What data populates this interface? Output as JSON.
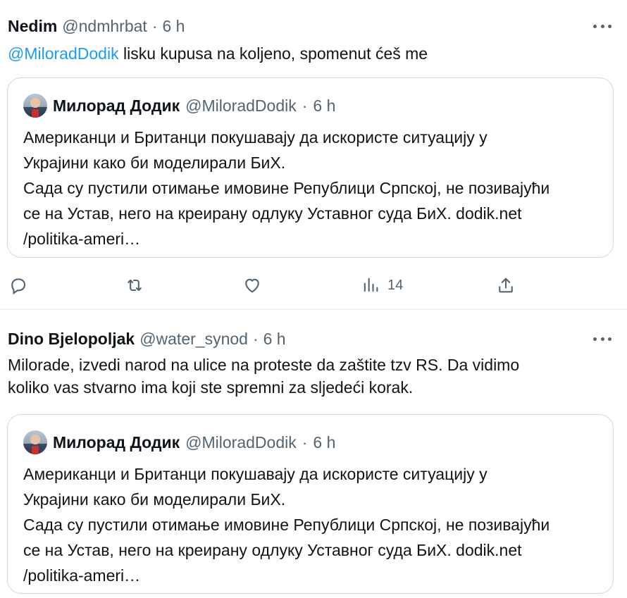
{
  "replies": [
    {
      "author_name": "Nedim",
      "handle": "@ndmhrbat",
      "separator": "·",
      "time": "6 h",
      "mention": "@MiloradDodik",
      "text": " lisku kupusa na koljeno, spomenut ćeš me",
      "quote": {
        "author_name": "Милорад Додик",
        "handle": "@MiloradDodik",
        "separator": "·",
        "time": "6 h",
        "line1": "Американци и Британци покушавају да искористе ситуацију у",
        "line2": "Украјини како би моделирали БиХ.",
        "line3": "Сада су пустили отимање имовине Републици Српској, не позивајући",
        "line4": "се на Устав, него на креирану одлуку Уставног суда БиХ. dodik.net",
        "line5": "/politika-ameri…"
      },
      "actions": {
        "views_count": "14"
      }
    },
    {
      "author_name": "Dino Bjelopoljak",
      "handle": "@water_synod",
      "separator": "·",
      "time": "6 h",
      "text_line1": "Milorade, izvedi narod na ulice na proteste da zaštite tzv RS. Da vidimo",
      "text_line2": "koliko vas stvarno ima koji ste spremni za sljedeći korak.",
      "quote": {
        "author_name": "Милорад Додик",
        "handle": "@MiloradDodik",
        "separator": "·",
        "time": "6 h",
        "line1": "Американци и Британци покушавају да искористе ситуацију у",
        "line2": "Украјини како би моделирали БиХ.",
        "line3": "Сада су пустили отимање имовине Републици Српској, не позивајући",
        "line4": "се на Устав, него на креирану одлуку Уставног суда БиХ. dodik.net",
        "line5": "/politika-ameri…"
      }
    }
  ],
  "icons": {
    "reply": "reply-icon",
    "repost": "repost-icon",
    "like": "like-icon",
    "views": "views-icon",
    "share": "share-icon",
    "more": "more-icon"
  },
  "colors": {
    "accent": "#1d9bf0",
    "text": "#0f1419",
    "muted": "#536471",
    "border": "#cfd9de"
  }
}
